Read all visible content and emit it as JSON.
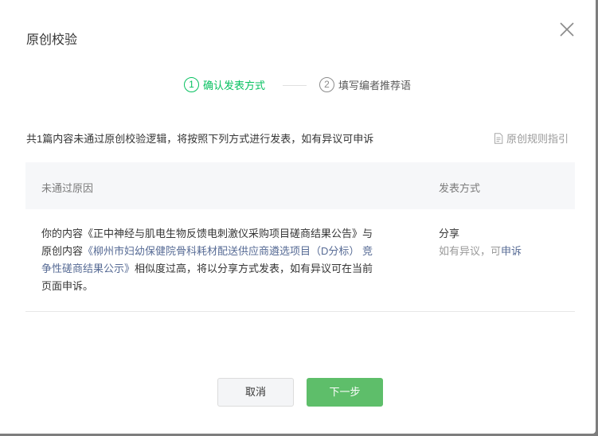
{
  "dialog": {
    "title": "原创校验",
    "close_icon": "close-icon"
  },
  "steps": [
    {
      "num": "1",
      "label": "确认发表方式",
      "active": true
    },
    {
      "num": "2",
      "label": "填写编者推荐语",
      "active": false
    }
  ],
  "summary": "共1篇内容未通过原创校验逻辑，将按照下列方式进行发表，如有异议可申诉",
  "guide": {
    "label": "原创规则指引",
    "icon": "document-icon"
  },
  "table": {
    "headers": [
      "未通过原因",
      "发表方式"
    ],
    "rows": [
      {
        "reason_prefix": "你的内容《正中神经与肌电生物反馈电刺激仪采购项目磋商结果公告》与原创内容",
        "reason_link": "《柳州市妇幼保健院骨科耗材配送供应商遴选项目（D分标） 竞争性磋商结果公示》",
        "reason_suffix": "相似度过高，将以分享方式发表，如有异议可在当前页面申诉。",
        "method": "分享",
        "method_note_prefix": "如有异议，可",
        "method_note_link": "申诉"
      }
    ]
  },
  "buttons": {
    "cancel": "取消",
    "next": "下一步"
  },
  "colors": {
    "accent": "#07c160",
    "button_primary": "#5ebe6a",
    "link": "#576b95"
  }
}
